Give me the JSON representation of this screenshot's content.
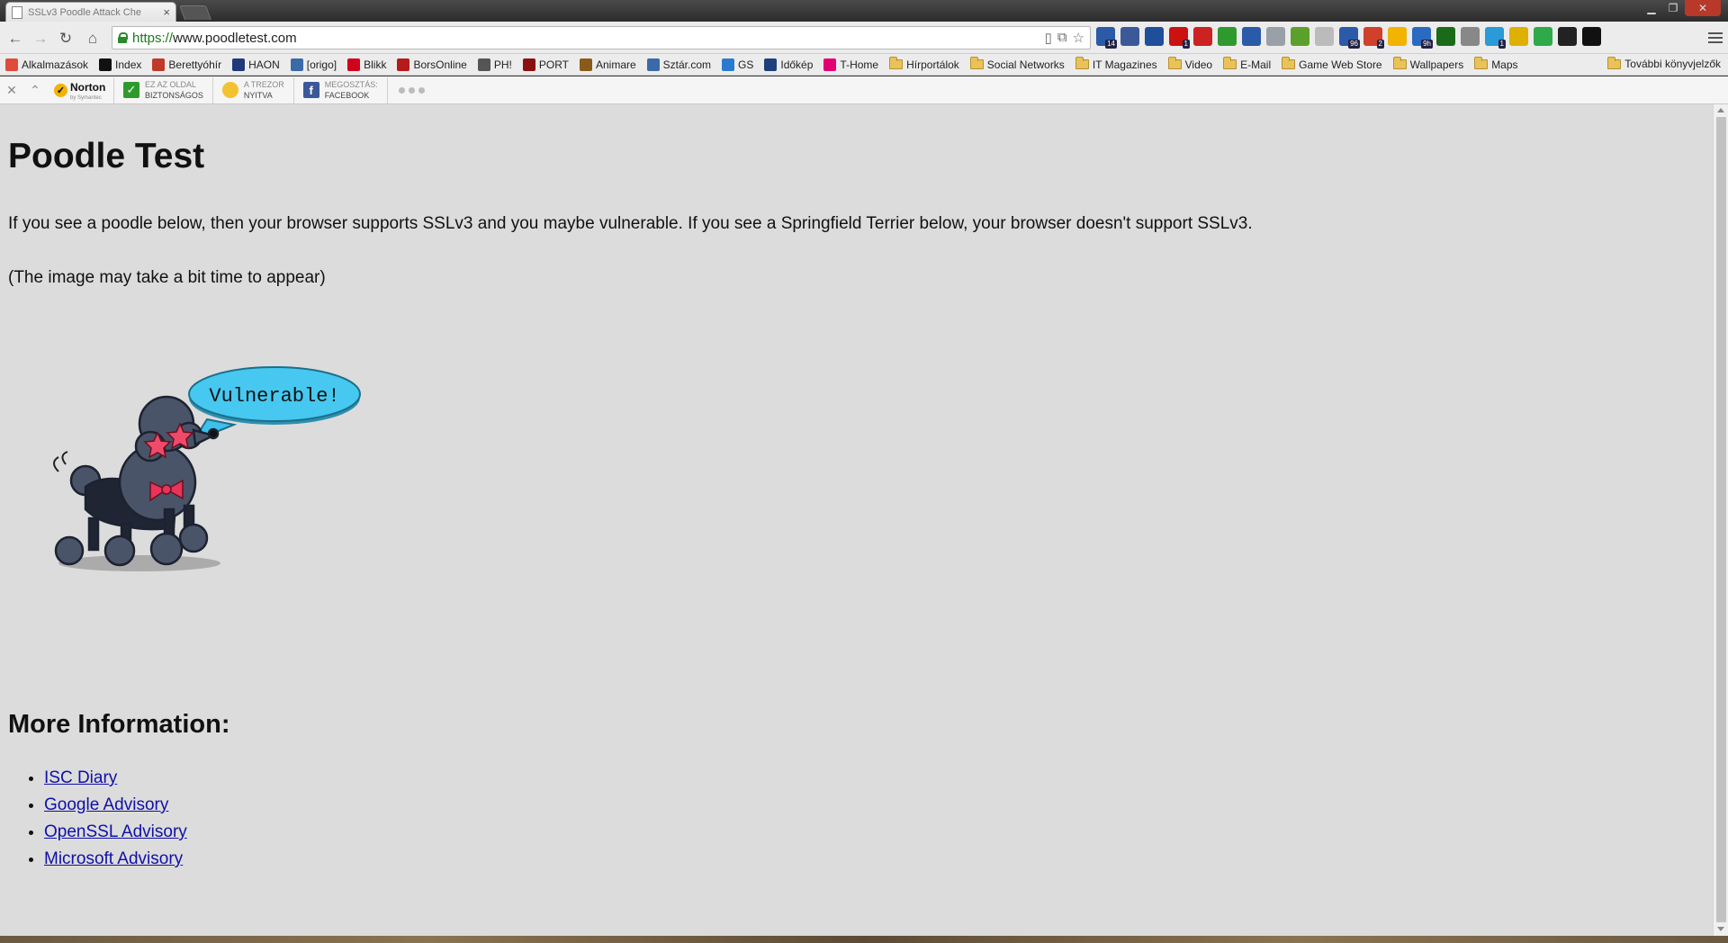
{
  "browser": {
    "tab_title": "SSLv3 Poodle Attack Che",
    "url_scheme": "https://",
    "url_host": "www.poodletest.com"
  },
  "bookmarks": {
    "items": [
      {
        "label": "Alkalmazások",
        "icon": "apps-icon",
        "color": "#e04a3a"
      },
      {
        "label": "Index",
        "icon": "index-icon",
        "color": "#111111"
      },
      {
        "label": "Berettyóhír",
        "icon": "feather-icon",
        "color": "#c0392b"
      },
      {
        "label": "HAON",
        "icon": "haon-icon",
        "color": "#1f3a7a"
      },
      {
        "label": "[origo]",
        "icon": "origo-icon",
        "color": "#3a6aa8"
      },
      {
        "label": "Blikk",
        "icon": "blikk-icon",
        "color": "#d0021b"
      },
      {
        "label": "BorsOnline",
        "icon": "bors-icon",
        "color": "#b51b1b"
      },
      {
        "label": "PH!",
        "icon": "ph-icon",
        "color": "#555555"
      },
      {
        "label": "PORT",
        "icon": "port-icon",
        "color": "#8a1010"
      },
      {
        "label": "Animare",
        "icon": "animare-icon",
        "color": "#8a5a1a"
      },
      {
        "label": "Sztár.com",
        "icon": "sztar-icon",
        "color": "#3a6aa8"
      },
      {
        "label": "GS",
        "icon": "gs-icon",
        "color": "#2a7ad0"
      },
      {
        "label": "Időkép",
        "icon": "idokep-icon",
        "color": "#1e3f7a"
      },
      {
        "label": "T-Home",
        "icon": "telekom-icon",
        "color": "#e20074"
      },
      {
        "label": "Hírportálok",
        "icon": "folder-icon",
        "color": "#e9c25a"
      },
      {
        "label": "Social Networks",
        "icon": "folder-icon",
        "color": "#e9c25a"
      },
      {
        "label": "IT Magazines",
        "icon": "folder-icon",
        "color": "#e9c25a"
      },
      {
        "label": "Video",
        "icon": "folder-icon",
        "color": "#e9c25a"
      },
      {
        "label": "E-Mail",
        "icon": "folder-icon",
        "color": "#e9c25a"
      },
      {
        "label": "Game Web Store",
        "icon": "folder-icon",
        "color": "#e9c25a"
      },
      {
        "label": "Wallpapers",
        "icon": "folder-icon",
        "color": "#e9c25a"
      },
      {
        "label": "Maps",
        "icon": "folder-icon",
        "color": "#e9c25a"
      }
    ],
    "more_label": "További könyvjelzők"
  },
  "extensions": [
    {
      "icon": "calendar-icon",
      "color": "#2a5aa8",
      "badge": "14"
    },
    {
      "icon": "facebook-icon",
      "color": "#3b5998",
      "badge": ""
    },
    {
      "icon": "puzzle-icon",
      "color": "#1f4f9a",
      "badge": ""
    },
    {
      "icon": "opera-icon",
      "color": "#cc1111",
      "badge": "1"
    },
    {
      "icon": "asterisk-icon",
      "color": "#cc2222",
      "badge": ""
    },
    {
      "icon": "check-icon",
      "color": "#2e9a2e",
      "badge": ""
    },
    {
      "icon": "star-icon",
      "color": "#2a5aa8",
      "badge": ""
    },
    {
      "icon": "globe-icon",
      "color": "#9aa0a8",
      "badge": ""
    },
    {
      "icon": "evernote-icon",
      "color": "#5aa02a",
      "badge": ""
    },
    {
      "icon": "bell-icon",
      "color": "#bbbbbb",
      "badge": ""
    },
    {
      "icon": "feed-icon",
      "color": "#2a5aa8",
      "badge": "96"
    },
    {
      "icon": "gplus-icon",
      "color": "#d0402a",
      "badge": "2"
    },
    {
      "icon": "drive-icon",
      "color": "#f2b400",
      "badge": ""
    },
    {
      "icon": "monitor-icon",
      "color": "#2a6ac0",
      "badge": "9h"
    },
    {
      "icon": "record-icon",
      "color": "#1a6a1a",
      "badge": ""
    },
    {
      "icon": "mail-icon",
      "color": "#888888",
      "badge": ""
    },
    {
      "icon": "skype-icon",
      "color": "#2a9ad8",
      "badge": "1"
    },
    {
      "icon": "key-icon",
      "color": "#e0b000",
      "badge": ""
    },
    {
      "icon": "pushbullet-icon",
      "color": "#2eaa4a",
      "badge": ""
    },
    {
      "icon": "lastpass-icon",
      "color": "#222222",
      "badge": ""
    },
    {
      "icon": "todo-icon",
      "color": "#111111",
      "badge": ""
    }
  ],
  "norton_bar": {
    "brand": "Norton",
    "brand_sub": "by Symantec",
    "safe_line1": "EZ AZ OLDAL",
    "safe_line2": "BIZTONSÁGOS",
    "vault_line1": "A TREZOR",
    "vault_line2": "NYITVA",
    "share_line1": "MEGOSZTÁS:",
    "share_line2": "FACEBOOK"
  },
  "page": {
    "title": "Poodle Test",
    "paragraph1": "If you see a poodle below, then your browser supports SSLv3 and you maybe vulnerable. If you see a Springfield Terrier below, your browser doesn't support SSLv3.",
    "paragraph2": "(The image may take a bit time to appear)",
    "bubble_text": "Vulnerable!",
    "more_heading": "More Information:",
    "links": [
      "ISC Diary",
      "Google Advisory",
      "OpenSSL Advisory",
      "Microsoft Advisory"
    ]
  }
}
